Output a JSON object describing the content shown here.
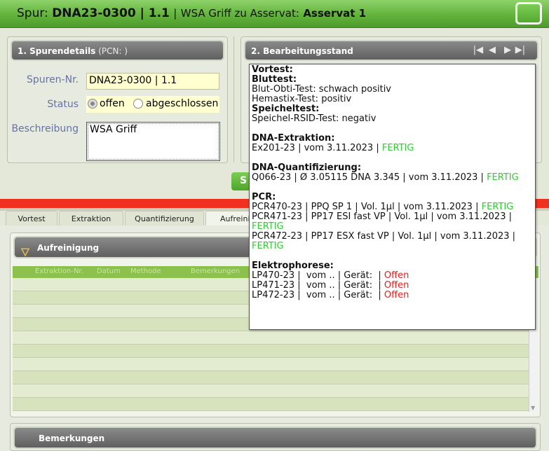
{
  "title": {
    "prefix": "Spur:",
    "code": "DNA23-0300 | 1.1",
    "separator": "|",
    "description": "WSA Griff zu Asservat:",
    "asservat": "Asservat 1"
  },
  "spurendetails": {
    "title": "1. Spurendetails",
    "pcn": "(PCN: )",
    "fields": {
      "spuren_nr_label": "Spuren-Nr.",
      "spuren_nr_value": "DNA23-0300 | 1.1",
      "status_label": "Status",
      "status_offen": "offen",
      "status_abgeschlossen": "abgeschlossen",
      "beschreibung_label": "Beschreibung",
      "beschreibung_value": "WSA Griff"
    }
  },
  "bearbeitungsstand": {
    "title": "2. Bearbeitungsstand",
    "nav": [
      "first-icon",
      "prev-icon",
      "next-icon",
      "last-icon"
    ]
  },
  "popup": {
    "vortest_h": "Vortest:",
    "bluttest_h": "Bluttest:",
    "blut_obti": "Blut-Obti-Test: schwach positiv",
    "hemastix": "Hemastix-Test: positiv",
    "speicheltest_h": "Speicheltest:",
    "speichel_rsid": "Speichel-RSID-Test: negativ",
    "dna_extraktion_h": "DNA-Extraktion:",
    "ex201": "Ex201-23 | vom 3.11.2023 | ",
    "ex201_status": "FERTIG",
    "dna_quant_h": "DNA-Quantifizierung:",
    "q066": "Q066-23 | Ø 3.05115 DNA 3.345 | vom 3.11.2023 | ",
    "q066_status": "FERTIG",
    "pcr_h": "PCR:",
    "pcr470": "PCR470-23 | PPQ SP 1 | Vol. 1µl | vom 3.11.2023 | ",
    "pcr470_status": "FERTIG",
    "pcr471": "PCR471-23 | PP17 ESI fast VP | Vol. 1µl | vom 3.11.2023 |",
    "pcr471_status": "FERTIG",
    "pcr472": "PCR472-23 | PP17 ESX fast VP | Vol. 1µl | vom 3.11.2023 |",
    "pcr472_status": "FERTIG",
    "elektro_h": "Elektrophorese:",
    "lp470": "LP470-23 |  vom .. | Gerät:  | ",
    "lp470_status": "Offen",
    "lp471": "LP471-23 |  vom .. | Gerät:  | ",
    "lp471_status": "Offen",
    "lp472": "LP472-23 |  vom .. | Gerät:  | ",
    "lp472_status": "Offen"
  },
  "save_button_partial": "S",
  "tabs": [
    "Vortest",
    "Extraktion",
    "Quantifizierung",
    "Aufreinig"
  ],
  "aufreinigung": {
    "title": "Aufreinigung",
    "columns": [
      "Extraktion-Nr.",
      "Datum",
      "Methode",
      "Bemerkungen"
    ]
  },
  "bemerkungen": {
    "title": "Bemerkungen"
  },
  "colors": {
    "titlebar_green": "#62b33c",
    "red_bar": "#f2301f",
    "fertig_green": "#35c935",
    "offen_red": "#e02020"
  }
}
